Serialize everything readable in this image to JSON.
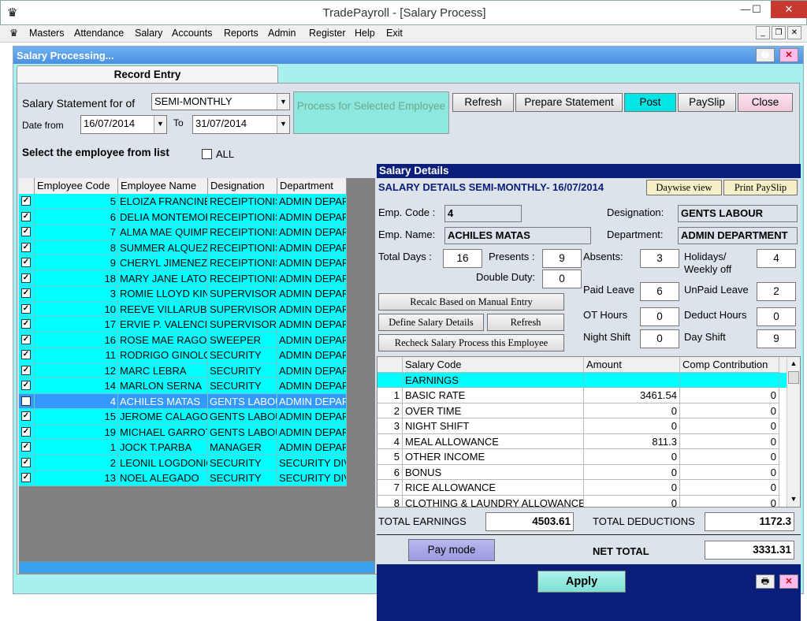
{
  "window": {
    "title": "TradePayroll - [Salary Process]",
    "minimize": "—",
    "maximize": "☐",
    "close": "✕"
  },
  "menu": [
    "Masters",
    "Attendance",
    "Salary",
    "Accounts",
    "Reports",
    "Admin",
    "Register",
    "Help",
    "Exit"
  ],
  "child": {
    "title": "Salary Processing...",
    "tab": "Record Entry"
  },
  "filters": {
    "statement_label": "Salary Statement for of",
    "statement_value": "SEMI-MONTHLY",
    "date_from_label": "Date from",
    "date_from": "16/07/2014",
    "to_label": "To",
    "date_to": "31/07/2014"
  },
  "buttons": {
    "process": "Process for Selected Employee",
    "refresh": "Refresh",
    "prepare": "Prepare Statement",
    "post": "Post",
    "payslip": "PaySlip",
    "close": "Close"
  },
  "employee_list": {
    "label": "Select the employee from list",
    "all_label": "ALL",
    "columns": [
      "Employee Code",
      "Employee Name",
      "Designation",
      "Department"
    ],
    "rows": [
      {
        "code": "5",
        "name": "ELOIZA FRANCINE",
        "designation": "RECEIPTIONIST",
        "department": "ADMIN DEPARTMENT"
      },
      {
        "code": "6",
        "name": "DELIA MONTEMOR",
        "designation": "RECEIPTIONIST",
        "department": "ADMIN DEPARTMENT"
      },
      {
        "code": "7",
        "name": "ALMA MAE QUIMPO",
        "designation": "RECEIPTIONIST",
        "department": "ADMIN DEPARTMENT"
      },
      {
        "code": "8",
        "name": "SUMMER ALQUEZA",
        "designation": "RECEIPTIONIST",
        "department": "ADMIN DEPARTMENT"
      },
      {
        "code": "9",
        "name": "CHERYL JIMENEZ",
        "designation": "RECEIPTIONIST",
        "department": "ADMIN DEPARTMENT"
      },
      {
        "code": "18",
        "name": "MARY JANE LATORRE",
        "designation": "RECEIPTIONIST",
        "department": "ADMIN DEPARTMENT"
      },
      {
        "code": "3",
        "name": "ROMIE LLOYD KING",
        "designation": "SUPERVISOR",
        "department": "ADMIN DEPARTMENT"
      },
      {
        "code": "10",
        "name": "REEVE VILLARUBIA",
        "designation": "SUPERVISOR",
        "department": "ADMIN DEPARTMENT"
      },
      {
        "code": "17",
        "name": "ERVIE P. VALENCIA",
        "designation": "SUPERVISOR",
        "department": "ADMIN DEPARTMENT"
      },
      {
        "code": "16",
        "name": "ROSE MAE RAGOS",
        "designation": "SWEEPER",
        "department": "ADMIN DEPARTMENT"
      },
      {
        "code": "11",
        "name": "RODRIGO GINOLOS",
        "designation": "SECURITY",
        "department": "ADMIN DEPARTMENT"
      },
      {
        "code": "12",
        "name": "MARC LEBRA",
        "designation": "SECURITY",
        "department": "ADMIN DEPARTMENT"
      },
      {
        "code": "14",
        "name": "MARLON SERNA",
        "designation": "SECURITY",
        "department": "ADMIN DEPARTMENT"
      },
      {
        "code": "4",
        "name": "ACHILES MATAS",
        "designation": "GENTS LABOUR",
        "department": "ADMIN DEPARTMENT",
        "selected": true
      },
      {
        "code": "15",
        "name": "JEROME CALAGOS",
        "designation": "GENTS LABOUR",
        "department": "ADMIN DEPARTMENT"
      },
      {
        "code": "19",
        "name": "MICHAEL GARROTE",
        "designation": "GENTS LABOUR",
        "department": "ADMIN DEPARTMENT"
      },
      {
        "code": "1",
        "name": "JOCK T.PARBA",
        "designation": "MANAGER",
        "department": "ADMIN DEPARTMENT"
      },
      {
        "code": "2",
        "name": "LEONIL LOGDONIO",
        "designation": "SECURITY",
        "department": "SECURITY DIVISION"
      },
      {
        "code": "13",
        "name": "NOEL ALEGADO",
        "designation": "SECURITY",
        "department": "SECURITY DIVISION"
      }
    ]
  },
  "salary_details": {
    "header": "Salary Details",
    "subheader": "SALARY DETAILS SEMI-MONTHLY- 16/07/2014",
    "daywise": "Daywise view",
    "print_payslip": "Print PaySlip",
    "emp_code_label": "Emp. Code :",
    "emp_code": "4",
    "emp_name_label": "Emp. Name:",
    "emp_name": "ACHILES MATAS",
    "designation_label": "Designation:",
    "designation": "GENTS LABOUR",
    "department_label": "Department:",
    "department": "ADMIN DEPARTMENT",
    "total_days_label": "Total Days :",
    "total_days": "16",
    "presents_label": "Presents :",
    "presents": "9",
    "double_duty_label": "Double Duty:",
    "double_duty": "0",
    "absents_label": "Absents:",
    "absents": "3",
    "holidays_label1": "Holidays/",
    "holidays_label2": "Weekly off",
    "holidays": "4",
    "paid_leave_label": "Paid Leave",
    "paid_leave": "6",
    "unpaid_leave_label": "UnPaid Leave",
    "unpaid_leave": "2",
    "ot_hours_label": "OT Hours",
    "ot_hours": "0",
    "deduct_hours_label": "Deduct Hours",
    "deduct_hours": "0",
    "night_shift_label": "Night Shift",
    "night_shift": "0",
    "day_shift_label": "Day Shift",
    "day_shift": "9",
    "recalc": "Recalc Based on Manual Entry",
    "define": "Define Salary Details",
    "refresh": "Refresh",
    "recheck": "Recheck  Salary Process this Employee",
    "grid_columns": [
      "Salary Code",
      "Amount",
      "Comp Contribution"
    ],
    "earnings_label": "EARNINGS",
    "grid_rows": [
      {
        "no": "1",
        "code": "BASIC RATE",
        "amount": "3461.54",
        "comp": "0"
      },
      {
        "no": "2",
        "code": "OVER TIME",
        "amount": "0",
        "comp": "0"
      },
      {
        "no": "3",
        "code": "NIGHT SHIFT",
        "amount": "0",
        "comp": "0"
      },
      {
        "no": "4",
        "code": "MEAL ALLOWANCE",
        "amount": "811.3",
        "comp": "0"
      },
      {
        "no": "5",
        "code": "OTHER INCOME",
        "amount": "0",
        "comp": "0"
      },
      {
        "no": "6",
        "code": "BONUS",
        "amount": "0",
        "comp": "0"
      },
      {
        "no": "7",
        "code": "RICE ALLOWANCE",
        "amount": "0",
        "comp": "0"
      },
      {
        "no": "8",
        "code": "CLOTHING & LAUNDRY ALLOWANCE",
        "amount": "0",
        "comp": "0"
      }
    ],
    "total_earnings_label": "TOTAL EARNINGS",
    "total_earnings": "4503.61",
    "total_deductions_label": "TOTAL DEDUCTIONS",
    "total_deductions": "1172.3",
    "pay_mode": "Pay mode",
    "net_total_label": "NET TOTAL",
    "net_total": "3331.31",
    "apply": "Apply"
  }
}
